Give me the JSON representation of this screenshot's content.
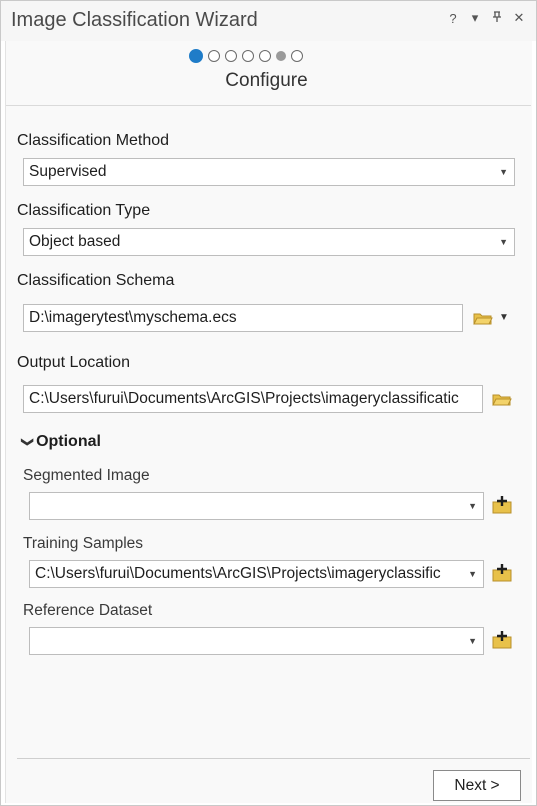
{
  "window": {
    "title": "Image Classification Wizard",
    "icons": [
      "help-icon",
      "chevron-down-icon",
      "pin-icon",
      "close-icon"
    ],
    "help_glyph": "?",
    "menu_glyph": "▾",
    "pin_glyph": "⊥",
    "close_glyph": "✕"
  },
  "wizard": {
    "total_steps": 7,
    "current_step": 1,
    "step_title": "Configure"
  },
  "form": {
    "classification_method": {
      "label": "Classification Method",
      "value": "Supervised"
    },
    "classification_type": {
      "label": "Classification Type",
      "value": "Object based"
    },
    "classification_schema": {
      "label": "Classification Schema",
      "value": "D:\\imagerytest\\myschema.ecs"
    },
    "output_location": {
      "label": "Output Location",
      "value": "C:\\Users\\furui\\Documents\\ArcGIS\\Projects\\imageryclassificatic"
    }
  },
  "optional": {
    "label": "Optional",
    "segmented_image": {
      "label": "Segmented Image",
      "value": ""
    },
    "training_samples": {
      "label": "Training Samples",
      "value": "C:\\Users\\furui\\Documents\\ArcGIS\\Projects\\imageryclassific"
    },
    "reference_dataset": {
      "label": "Reference Dataset",
      "value": ""
    }
  },
  "footer": {
    "next_label": "Next >"
  },
  "colors": {
    "accent": "#1f7cc8",
    "folder": "#e8c14a"
  }
}
